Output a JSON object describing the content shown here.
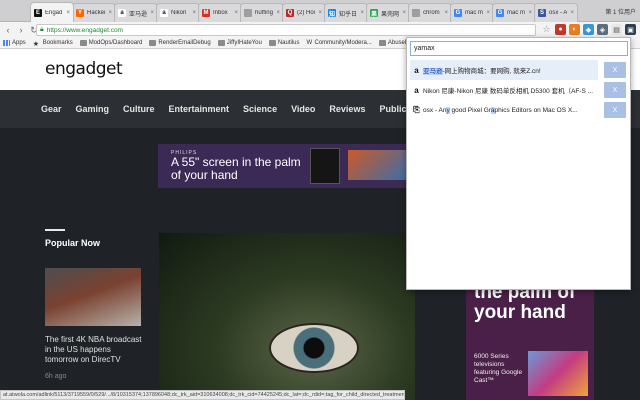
{
  "tabs": [
    {
      "label": "Engad",
      "icon": "engadget-icon",
      "color": "#111111",
      "glyph": "E",
      "active": true
    },
    {
      "label": "Hacker",
      "icon": "hackernews-icon",
      "color": "#ff6600",
      "glyph": "Y",
      "active": false
    },
    {
      "label": "亚马逊",
      "icon": "amazon-icon",
      "color": "#ffffff",
      "glyph": "a",
      "active": false
    },
    {
      "label": "Nikon",
      "icon": "amazon-icon",
      "color": "#ffffff",
      "glyph": "a",
      "active": false
    },
    {
      "label": "Inbox",
      "icon": "gmail-icon",
      "color": "#d93025",
      "glyph": "M",
      "active": false
    },
    {
      "label": "huffing",
      "icon": "page-icon",
      "color": "#9e9e9e",
      "glyph": "",
      "active": false
    },
    {
      "label": "(2) Hoi",
      "icon": "quora-icon",
      "color": "#b92b27",
      "glyph": "Q",
      "active": false
    },
    {
      "label": "知乎日",
      "icon": "zhihu-icon",
      "color": "#0f88eb",
      "glyph": "知",
      "active": false
    },
    {
      "label": "果壳网",
      "icon": "guokr-icon",
      "color": "#2ea44f",
      "glyph": "果",
      "active": false
    },
    {
      "label": "chrom",
      "icon": "page-icon",
      "color": "#9e9e9e",
      "glyph": "",
      "active": false
    },
    {
      "label": "mac m",
      "icon": "google-icon",
      "color": "#4285f4",
      "glyph": "G",
      "active": false
    },
    {
      "label": "mac m",
      "icon": "google-icon",
      "color": "#4285f4",
      "glyph": "G",
      "active": false
    },
    {
      "label": "osx - A",
      "icon": "stackexchange-icon",
      "color": "#3b5998",
      "glyph": "S",
      "active": false
    }
  ],
  "corner_text": "第 1 位用户",
  "address": {
    "url": "https://www.engadget.com"
  },
  "bookmarks": [
    {
      "label": "Apps",
      "icon": "apps-icon"
    },
    {
      "label": "Bookmarks",
      "icon": "star-icon"
    },
    {
      "label": "ModOps/Dashboard",
      "icon": "folder-icon"
    },
    {
      "label": "RenderEmailDebug",
      "icon": "folder-icon"
    },
    {
      "label": "JiffyIHateYou",
      "icon": "folder-icon"
    },
    {
      "label": "Nautilus",
      "icon": "folder-icon"
    },
    {
      "label": "Community/Modera...",
      "icon": "wikipedia-icon"
    },
    {
      "label": "AbusePreventio",
      "icon": "folder-icon"
    }
  ],
  "site": {
    "logo": "engadget",
    "nav": [
      "Gear",
      "Gaming",
      "Culture",
      "Entertainment",
      "Science",
      "Video",
      "Reviews",
      "Public Access"
    ],
    "ad": {
      "brand": "PHILIPS",
      "headline": "A 55\" screen in the palm of your hand"
    },
    "popular": {
      "title": "Popular Now",
      "item_title": "The first 4K NBA broadcast in the US happens tomorrow on DirecTV",
      "item_time": "6h ago"
    },
    "side_ad": {
      "big": "the palm of your hand",
      "small": "6000 Series televisions featuring Google Cast™"
    }
  },
  "status_bar": "at.atwola.com/adlink/5113/3719559/0/529/.../8/10315374;137896048;dc_trk_aid=310634008;dc_trk_cid=74425245;dc_lat=;dc_rdid=;tag_for_child_directed_treatment=",
  "popup": {
    "query": "yamax",
    "results": [
      {
        "icon": "amazon-icon",
        "glyph": "a",
        "pre": "",
        "hl1": "亚马逊",
        "mid": "-网上购物商城：要网购, 就来Z.cn!",
        "hl2": "",
        "post": "",
        "close": "X",
        "selected": true
      },
      {
        "icon": "amazon-icon",
        "glyph": "a",
        "pre": "Nikon 尼康-Nikon 尼康 数码单反相机 D5300 套机（AF-S ...",
        "hl1": "",
        "mid": "",
        "hl2": "",
        "post": "",
        "close": "X",
        "selected": false
      },
      {
        "icon": "stackexchange-icon",
        "glyph": "S",
        "pre": "osx - An",
        "hl1": "y",
        "mid": " good Pixel Gr",
        "hl2": "a",
        "post": "phics Editors on Mac OS X...",
        "close": "X",
        "selected": false
      }
    ]
  }
}
